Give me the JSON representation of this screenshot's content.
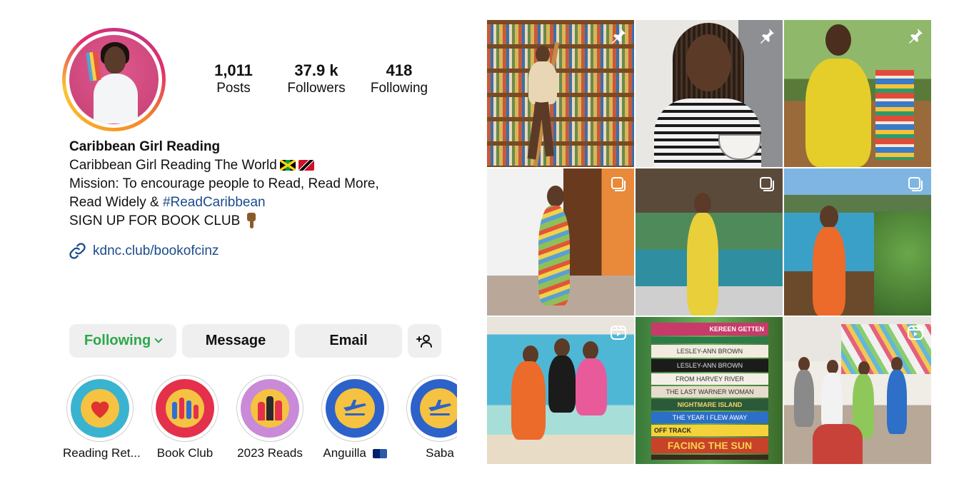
{
  "profile": {
    "stats": [
      {
        "value": "1,011",
        "label": "Posts"
      },
      {
        "value": "37.9 k",
        "label": "Followers"
      },
      {
        "value": "418",
        "label": "Following"
      }
    ],
    "display_name": "Caribbean Girl Reading",
    "bio_line1": "Caribbean Girl Reading The World",
    "bio_line2": "Mission: To encourage people to Read, Read More,",
    "bio_line3_prefix": "Read Widely &",
    "bio_hashtag": "#ReadCaribbean",
    "bio_line4": "SIGN UP FOR BOOK CLUB",
    "link": "kdnc.club/bookofcinz"
  },
  "actions": {
    "following_label": "Following",
    "message_label": "Message",
    "email_label": "Email"
  },
  "highlights": [
    {
      "label": "Reading Ret...",
      "icon": "heart-icon"
    },
    {
      "label": "Book Club",
      "icon": "books-icon"
    },
    {
      "label": "2023 Reads",
      "icon": "books-icon"
    },
    {
      "label": "Anguilla",
      "icon": "airplane-icon"
    },
    {
      "label": "Saba",
      "icon": "airplane-icon"
    }
  ],
  "grid": {
    "posts": [
      {
        "badge": "pin-icon"
      },
      {
        "badge": "pin-icon"
      },
      {
        "badge": "pin-icon"
      },
      {
        "badge": "carousel-icon"
      },
      {
        "badge": "carousel-icon"
      },
      {
        "badge": "carousel-icon"
      },
      {
        "badge": "reel-icon"
      },
      {
        "badge": "none"
      },
      {
        "badge": "reel-icon"
      }
    ],
    "book_spines": [
      "KEREEN GETTEN",
      "LESLEY-ANN BROWN",
      "LESLEY-ANN BROWN",
      "FROM HARVEY RIVER",
      "THE LAST WARNER WOMAN",
      "NIGHTMARE ISLAND",
      "THE YEAR I FLEW AWAY",
      "OFF TRACK",
      "FACING THE SUN"
    ]
  },
  "colors": {
    "following_green": "#2ca84a",
    "link_blue": "#1a4b8c",
    "button_bg": "#efefef"
  }
}
